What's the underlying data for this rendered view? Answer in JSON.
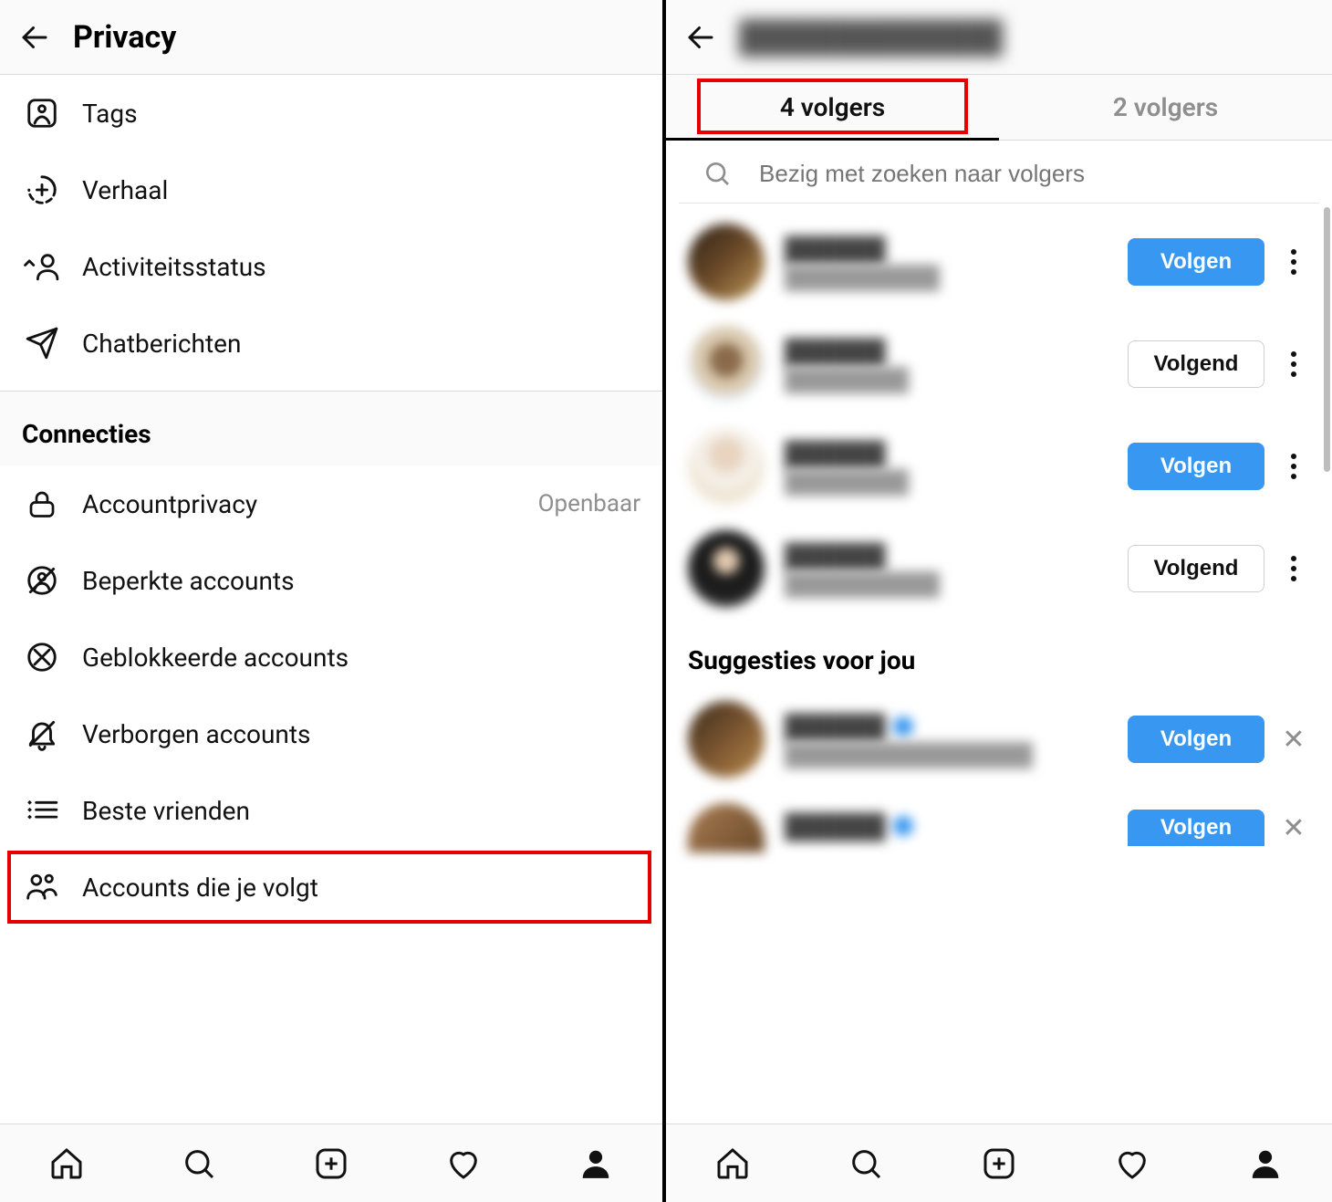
{
  "left": {
    "header_title": "Privacy",
    "rows": [
      {
        "id": "tags",
        "label": "Tags"
      },
      {
        "id": "verhaal",
        "label": "Verhaal"
      },
      {
        "id": "activiteitsstatus",
        "label": "Activiteitsstatus"
      },
      {
        "id": "chatberichten",
        "label": "Chatberichten"
      }
    ],
    "section_header": "Connecties",
    "rows2": [
      {
        "id": "accountprivacy",
        "label": "Accountprivacy",
        "meta": "Openbaar"
      },
      {
        "id": "beperkte",
        "label": "Beperkte accounts"
      },
      {
        "id": "geblokkeerde",
        "label": "Geblokkeerde accounts"
      },
      {
        "id": "verborgen",
        "label": "Verborgen accounts"
      },
      {
        "id": "bestevrienden",
        "label": "Beste vrienden"
      },
      {
        "id": "accountsvolgt",
        "label": "Accounts die je volgt",
        "highlight": true
      }
    ]
  },
  "right": {
    "header_title": "████████████",
    "tabs": [
      {
        "label": "4 volgers",
        "active": true,
        "highlight": true
      },
      {
        "label": "2 volgers",
        "active": false
      }
    ],
    "search_placeholder": "Bezig met zoeken naar volgers",
    "followers": [
      {
        "uname": "██████",
        "dname": "██████████",
        "button": "Volgen",
        "button_type": "primary",
        "action": "more",
        "avatar": "a1"
      },
      {
        "uname": "██████",
        "dname": "████████",
        "button": "Volgend",
        "button_type": "secondary",
        "action": "more",
        "avatar": "a2"
      },
      {
        "uname": "██████",
        "dname": "████████",
        "button": "Volgen",
        "button_type": "primary",
        "action": "more",
        "avatar": "a3"
      },
      {
        "uname": "██████",
        "dname": "██████████",
        "button": "Volgend",
        "button_type": "secondary",
        "action": "more",
        "avatar": "a4"
      }
    ],
    "suggestion_header": "Suggesties voor jou",
    "suggestions": [
      {
        "uname": "██████",
        "dname": "████████████████",
        "button": "Volgen",
        "button_type": "primary",
        "action": "close",
        "verified": true,
        "avatar": "a5"
      },
      {
        "uname": "██████",
        "dname": "████",
        "button": "Volgen",
        "button_type": "primary",
        "action": "close",
        "verified": true,
        "avatar": "a6",
        "partial": true
      }
    ]
  }
}
